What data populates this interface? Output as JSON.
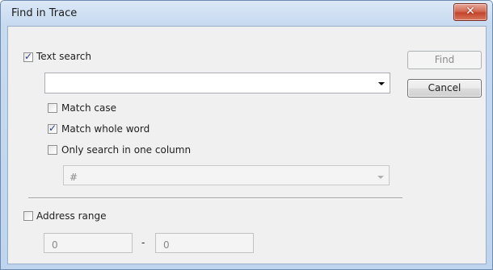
{
  "window": {
    "title": "Find in Trace",
    "close_label": "✕"
  },
  "text_search": {
    "checkbox_label": "Text search",
    "checked": true,
    "query_value": ""
  },
  "options": {
    "match_case": {
      "label": "Match case",
      "checked": false
    },
    "match_whole_word": {
      "label": "Match whole word",
      "checked": true
    },
    "one_column": {
      "label": "Only search in one column",
      "checked": false,
      "column_value": "#"
    }
  },
  "address_range": {
    "checkbox_label": "Address range",
    "checked": false,
    "from_value": "0",
    "separator": "-",
    "to_value": "0"
  },
  "buttons": {
    "find_label": "Find",
    "cancel_label": "Cancel"
  }
}
